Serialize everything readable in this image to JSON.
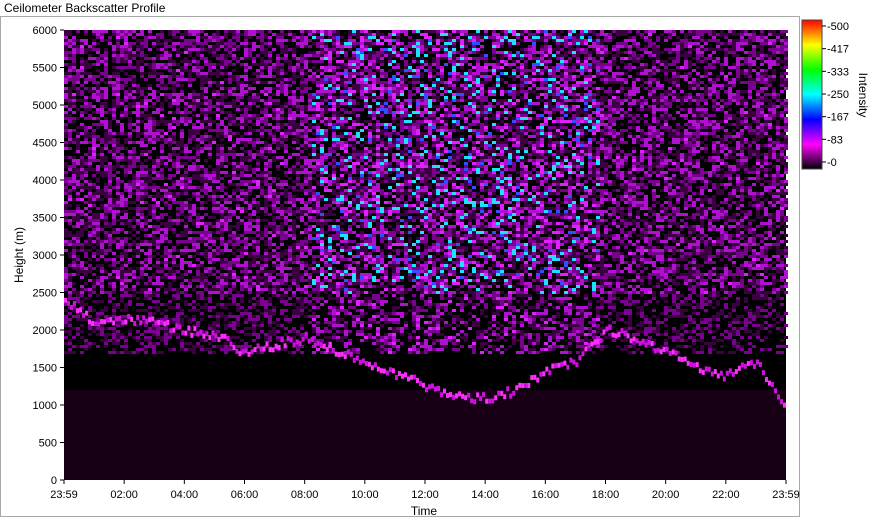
{
  "window": {
    "title": "Ceilometer Backscatter Profile"
  },
  "chart_data": {
    "type": "heatmap",
    "xlabel": "Time",
    "ylabel": "Height (m)",
    "xlim": [
      "23:59",
      "23:59"
    ],
    "ylim": [
      0,
      6000
    ],
    "x_ticks": [
      "23:59",
      "02:00",
      "04:00",
      "06:00",
      "08:00",
      "10:00",
      "12:00",
      "14:00",
      "16:00",
      "18:00",
      "20:00",
      "22:00",
      "23:59"
    ],
    "y_ticks": [
      0,
      500,
      1000,
      1500,
      2000,
      2500,
      3000,
      3500,
      4000,
      4500,
      5000,
      5500,
      6000
    ],
    "colorbar": {
      "label": "Intensity",
      "range": [
        0,
        500
      ],
      "ticks": [
        "0",
        "83",
        "167",
        "250",
        "333",
        "417",
        "500"
      ],
      "colors": [
        "#000000",
        "#ff00ff",
        "#0000ff",
        "#00ffff",
        "#00ff00",
        "#ffff00",
        "#ff0000"
      ]
    },
    "features": {
      "cloud_base_layer": {
        "hours": [
          0,
          1,
          2,
          3,
          4,
          5,
          6,
          7,
          8,
          13,
          14,
          15,
          16,
          17,
          18,
          19,
          20,
          21,
          22,
          23,
          24
        ],
        "height_m": [
          2400,
          2100,
          2150,
          2100,
          2000,
          1950,
          1700,
          1800,
          1900,
          1100,
          1100,
          1200,
          1450,
          1600,
          2000,
          1900,
          1700,
          1500,
          1400,
          1600,
          900
        ]
      },
      "boundary_layer_top_m": 1200,
      "noise_intensity_peak_hours": [
        9,
        17
      ]
    }
  }
}
